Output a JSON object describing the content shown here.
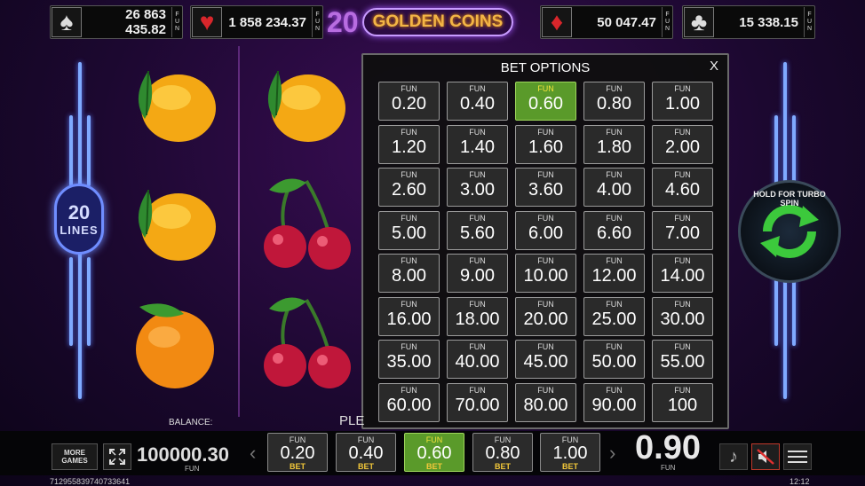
{
  "jackpots": [
    {
      "suit": "spade",
      "glyph": "♠",
      "amount": "26 863 435.82",
      "currency": "FUN"
    },
    {
      "suit": "heart",
      "glyph": "♥",
      "amount": "1 858 234.37",
      "currency": "FUN"
    },
    {
      "suit": "diamond",
      "glyph": "♦",
      "amount": "50 047.47",
      "currency": "FUN"
    },
    {
      "suit": "club",
      "glyph": "♣",
      "amount": "15 338.15",
      "currency": "FUN"
    }
  ],
  "logo": {
    "number": "20",
    "name": "GOLDEN COINS"
  },
  "lines_badge": {
    "count": "20",
    "label": "LINES"
  },
  "turbo_label": "HOLD FOR TURBO SPIN",
  "bet_options": {
    "title": "BET OPTIONS",
    "close": "X",
    "currency_label": "FUN",
    "selected": "0.60",
    "values": [
      "0.20",
      "0.40",
      "0.60",
      "0.80",
      "1.00",
      "1.20",
      "1.40",
      "1.60",
      "1.80",
      "2.00",
      "2.60",
      "3.00",
      "3.60",
      "4.00",
      "4.60",
      "5.00",
      "5.60",
      "6.00",
      "6.60",
      "7.00",
      "8.00",
      "9.00",
      "10.00",
      "12.00",
      "14.00",
      "16.00",
      "18.00",
      "20.00",
      "25.00",
      "30.00",
      "35.00",
      "40.00",
      "45.00",
      "50.00",
      "55.00",
      "60.00",
      "70.00",
      "80.00",
      "90.00",
      "100"
    ]
  },
  "footer": {
    "please_text": "PLE",
    "balance_label": "BALANCE:",
    "balance_value": "100000.30",
    "balance_currency": "FUN",
    "more_games": "MORE GAMES",
    "quick_bets": [
      {
        "currency": "FUN",
        "value": "0.20",
        "label": "BET",
        "selected": false
      },
      {
        "currency": "FUN",
        "value": "0.40",
        "label": "BET",
        "selected": false
      },
      {
        "currency": "FUN",
        "value": "0.60",
        "label": "BET",
        "selected": true
      },
      {
        "currency": "FUN",
        "value": "0.80",
        "label": "BET",
        "selected": false
      },
      {
        "currency": "FUN",
        "value": "1.00",
        "label": "BET",
        "selected": false
      }
    ],
    "total_bet": "0.90",
    "total_currency": "FUN",
    "game_id": "712955839740733641",
    "clock": "12:12"
  }
}
